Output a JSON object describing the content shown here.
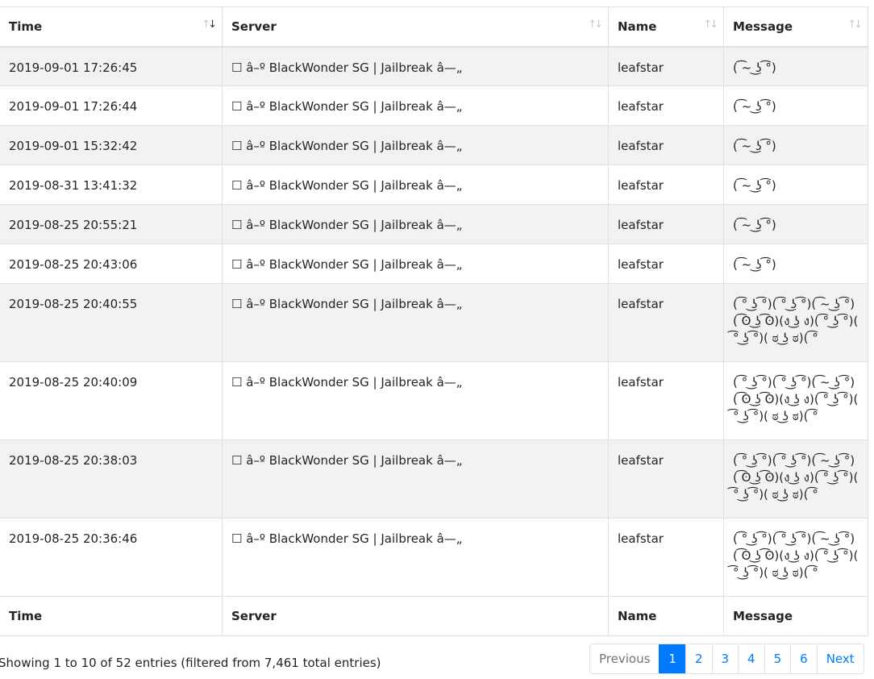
{
  "columns": {
    "time": "Time",
    "server": "Server",
    "name": "Name",
    "message": "Message"
  },
  "rows": [
    {
      "time": "2019-09-01 17:26:45",
      "server": "☐ â–º BlackWonder SG | Jailbreak â—„",
      "name": "leafstar",
      "message": "( ͡~ ͜ʖ ͡°)"
    },
    {
      "time": "2019-09-01 17:26:44",
      "server": "☐ â–º BlackWonder SG | Jailbreak â—„",
      "name": "leafstar",
      "message": "( ͡~ ͜ʖ ͡°)"
    },
    {
      "time": "2019-09-01 15:32:42",
      "server": "☐ â–º BlackWonder SG | Jailbreak â—„",
      "name": "leafstar",
      "message": "( ͡~ ͜ʖ ͡°)"
    },
    {
      "time": "2019-08-31 13:41:32",
      "server": "☐ â–º BlackWonder SG | Jailbreak â—„",
      "name": "leafstar",
      "message": "( ͡~ ͜ʖ ͡°)"
    },
    {
      "time": "2019-08-25 20:55:21",
      "server": "☐ â–º BlackWonder SG | Jailbreak â—„",
      "name": "leafstar",
      "message": "( ͡~ ͜ʖ ͡°)"
    },
    {
      "time": "2019-08-25 20:43:06",
      "server": "☐ â–º BlackWonder SG | Jailbreak â—„",
      "name": "leafstar",
      "message": "( ͡~ ͜ʖ ͡°)"
    },
    {
      "time": "2019-08-25 20:40:55",
      "server": "☐ â–º BlackWonder SG | Jailbreak â—„",
      "name": "leafstar",
      "message": "( ͡° ͜ʖ ͡°)( ͡° ͜ʖ ͡°)( ͡~ ͜ʖ ͡°)( ͡ʘ ͜ʖ ͡ʘ)(ง ͜ʖ ง)( ͡° ͜ʖ ͡°)( ͡° ͜ʖ ͡°)( ಠ ͜ʖ ಠ)( ͡°"
    },
    {
      "time": "2019-08-25 20:40:09",
      "server": "☐ â–º BlackWonder SG | Jailbreak â—„",
      "name": "leafstar",
      "message": "( ͡° ͜ʖ ͡°)( ͡° ͜ʖ ͡°)( ͡~ ͜ʖ ͡°)( ͡ʘ ͜ʖ ͡ʘ)(ง ͜ʖ ง)( ͡° ͜ʖ ͡°)( ͡° ͜ʖ ͡°)( ಠ ͜ʖ ಠ)( ͡°"
    },
    {
      "time": "2019-08-25 20:38:03",
      "server": "☐ â–º BlackWonder SG | Jailbreak â—„",
      "name": "leafstar",
      "message": "( ͡° ͜ʖ ͡°)( ͡° ͜ʖ ͡°)( ͡~ ͜ʖ ͡°)( ͡ʘ ͜ʖ ͡ʘ)(ง ͜ʖ ง)( ͡° ͜ʖ ͡°)( ͡° ͜ʖ ͡°)( ಠ ͜ʖ ಠ)( ͡°"
    },
    {
      "time": "2019-08-25 20:36:46",
      "server": "☐ â–º BlackWonder SG | Jailbreak â—„",
      "name": "leafstar",
      "message": "( ͡° ͜ʖ ͡°)( ͡° ͜ʖ ͡°)( ͡~ ͜ʖ ͡°)( ͡ʘ ͜ʖ ͡ʘ)(ง ͜ʖ ง)( ͡° ͜ʖ ͡°)( ͡° ͜ʖ ͡°)( ಠ ͜ʖ ಠ)( ͡°"
    }
  ],
  "sort": {
    "active_column": "time",
    "direction": "descending",
    "icon": "sort-arrows-icon"
  },
  "info": "Showing 1 to 10 of 52 entries (filtered from 7,461 total entries)",
  "pagination": {
    "previous": "Previous",
    "next": "Next",
    "pages": [
      "1",
      "2",
      "3",
      "4",
      "5",
      "6"
    ],
    "current": "1"
  },
  "colors": {
    "accent": "#007bff",
    "stripe": "#f2f2f2",
    "border": "#dee2e6",
    "text": "#212529",
    "muted": "#6c757d"
  }
}
